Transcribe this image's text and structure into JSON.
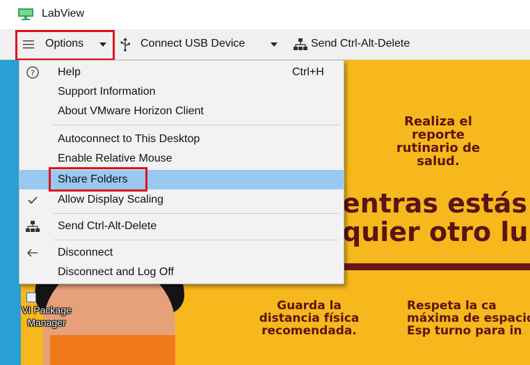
{
  "window": {
    "title": "LabView",
    "icon": "monitor-icon",
    "icon_color": "#2fa84f"
  },
  "toolbar": {
    "options_label": "Options",
    "usb_label": "Connect USB Device",
    "cad_label": "Send Ctrl-Alt-Delete"
  },
  "menu": {
    "items": [
      {
        "label": "Help",
        "shortcut": "Ctrl+H",
        "icon": "help-circle-icon"
      },
      {
        "label": "Support Information"
      },
      {
        "label": "About VMware Horizon Client"
      },
      {
        "label": "Autoconnect to This Desktop"
      },
      {
        "label": "Enable Relative Mouse"
      },
      {
        "label": "Share Folders"
      },
      {
        "label": "Allow Display Scaling",
        "icon": "checkmark-icon",
        "checked": true,
        "highlighted": true
      },
      {
        "label": "Send Ctrl-Alt-Delete",
        "icon": "network-icon"
      },
      {
        "label": "Disconnect",
        "icon": "arrow-left-icon"
      },
      {
        "label": "Disconnect and Log Off"
      }
    ],
    "highlight_color": "#99c9f1"
  },
  "desktop": {
    "background_color": "#f6b81c",
    "icon_label": "VI Package Manager",
    "poster": {
      "headline": "Realiza el reporte rutinario de salud.",
      "big_line1": "entras estás",
      "big_line2": "quier otro lu",
      "left_block": "Guarda la distancia física recomendada.",
      "right_block": "Respeta la ca máxima de espacio. Esp turno para in"
    }
  },
  "annotations": {
    "box_color": "#e0101a"
  }
}
